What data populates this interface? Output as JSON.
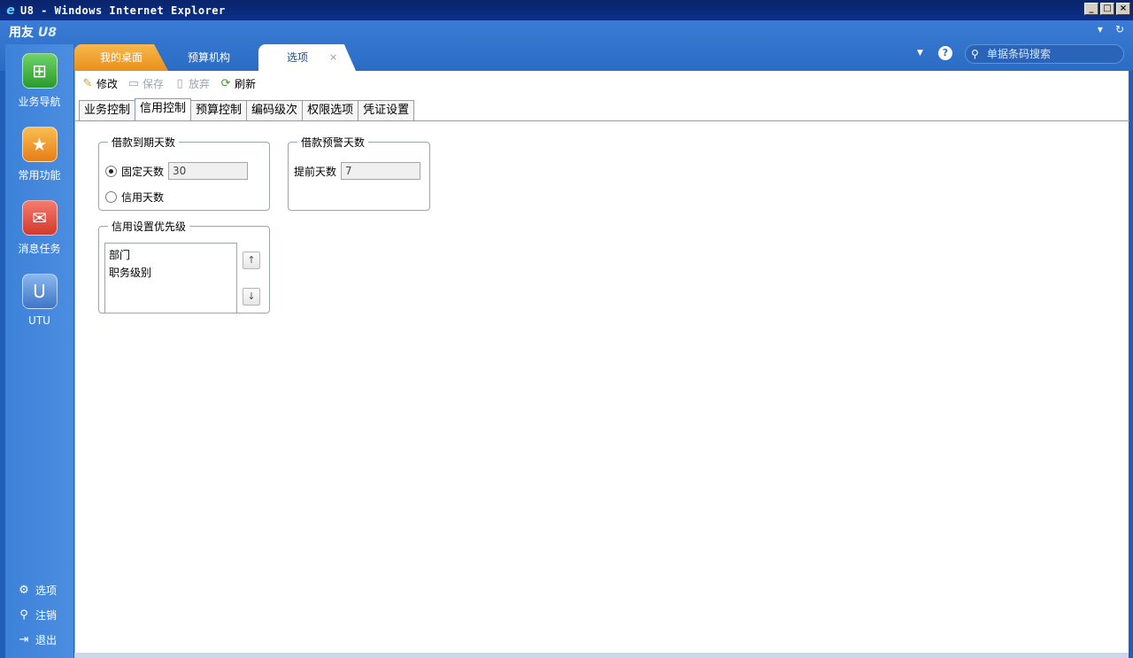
{
  "window": {
    "title": "U8 - Windows Internet Explorer",
    "ie_icon": "e",
    "min": "_",
    "max": "□",
    "close": "×"
  },
  "brand": {
    "prefix": "用友",
    "suffix": "U8"
  },
  "header_icons": {
    "pin": "▾",
    "restore": "↻"
  },
  "tabs": [
    {
      "label": "我的桌面"
    },
    {
      "label": "预算机构"
    },
    {
      "label": "选项",
      "close": "×"
    }
  ],
  "help": "?",
  "search": {
    "placeholder": "单据条码搜索"
  },
  "sidebar": {
    "items": [
      {
        "label": "业务导航",
        "icon": "⊞"
      },
      {
        "label": "常用功能",
        "icon": "★"
      },
      {
        "label": "消息任务",
        "icon": "✉"
      },
      {
        "label": "UTU",
        "icon": "U"
      }
    ],
    "bottom": [
      {
        "label": "选项",
        "icon": "⚙"
      },
      {
        "label": "注销",
        "icon": "⚲"
      },
      {
        "label": "退出",
        "icon": "⇥"
      }
    ]
  },
  "toolbar": {
    "edit": "修改",
    "save": "保存",
    "discard": "放弃",
    "refresh": "刷新",
    "edit_icon": "✎",
    "save_icon": "▭",
    "discard_icon": "▯",
    "refresh_icon": "⟳"
  },
  "subtabs": [
    "业务控制",
    "信用控制",
    "预算控制",
    "编码级次",
    "权限选项",
    "凭证设置"
  ],
  "loan_due": {
    "legend": "借款到期天数",
    "fixed_label": "固定天数",
    "fixed_value": "30",
    "credit_label": "信用天数"
  },
  "loan_warn": {
    "legend": "借款预警天数",
    "advance_label": "提前天数",
    "advance_value": "7"
  },
  "credit_priority": {
    "legend": "信用设置优先级",
    "items": [
      "部门",
      "职务级别"
    ],
    "up": "↑",
    "down": "↓"
  }
}
